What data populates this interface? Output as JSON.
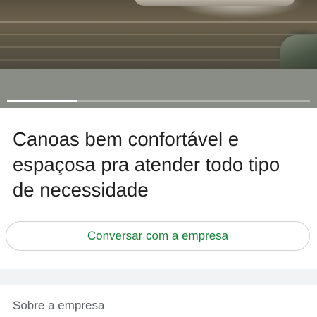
{
  "listing": {
    "description": "Canoas bem confortável e espaçosa pra atender todo tipo de necessidade",
    "chat_button_label": "Conversar com a empresa"
  },
  "photo_carousel": {
    "active_index": 0,
    "colors": {
      "indicator_active": "#ffffff",
      "indicator_inactive": "#b5b8b2"
    }
  },
  "about_section": {
    "heading": "Sobre a empresa"
  },
  "colors": {
    "accent_green": "#188038",
    "title_text": "#1f1f1f",
    "muted_text": "#5f6368",
    "divider_band": "#f1f3f4"
  }
}
